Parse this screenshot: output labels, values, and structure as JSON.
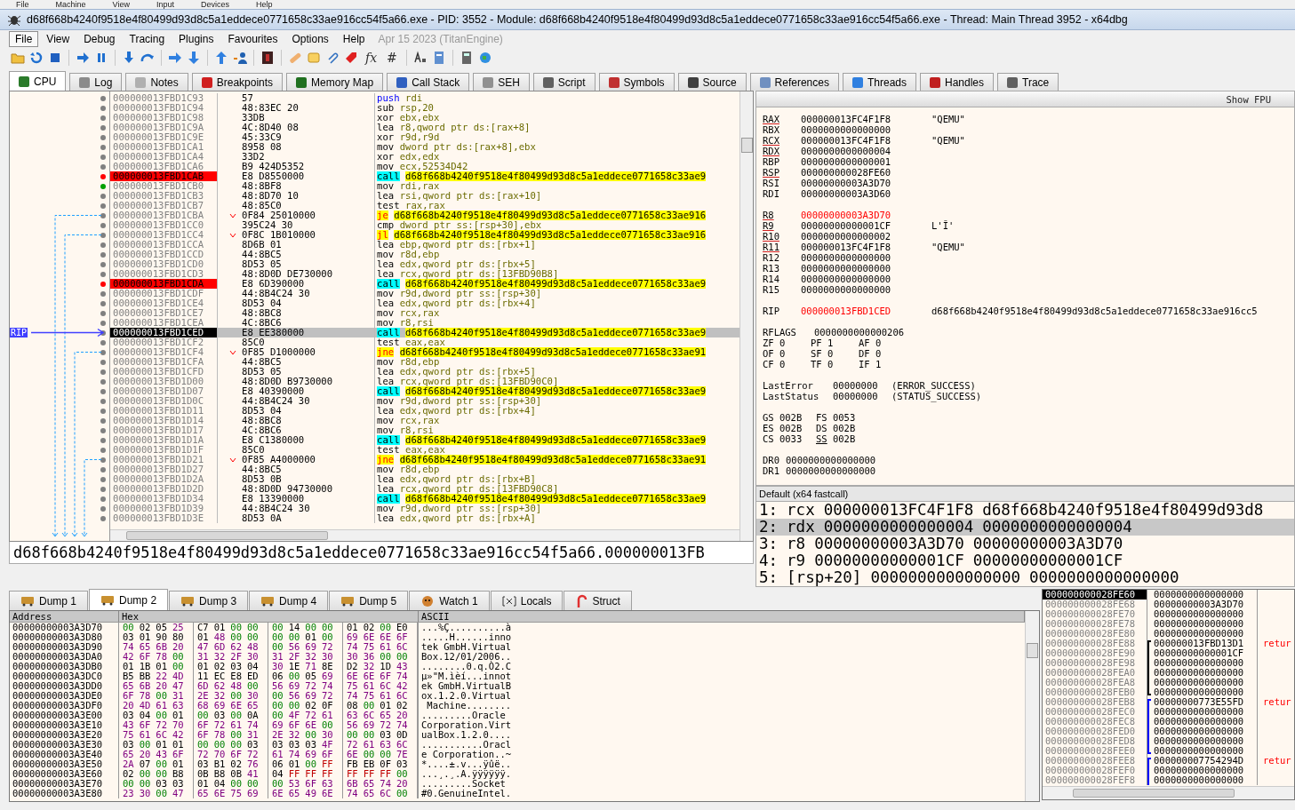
{
  "host_menu": [
    "File",
    "Machine",
    "View",
    "Input",
    "Devices",
    "Help"
  ],
  "title": "d68f668b4240f9518e4f80499d93d8c5a1eddece0771658c33ae916cc54f5a66.exe - PID: 3552 - Module: d68f668b4240f9518e4f80499d93d8c5a1eddece0771658c33ae916cc54f5a66.exe - Thread: Main Thread 3952 - x64dbg",
  "menu": {
    "items": [
      {
        "label": "File",
        "selected": true
      },
      {
        "label": "View",
        "selected": false
      },
      {
        "label": "Debug",
        "selected": false
      },
      {
        "label": "Tracing",
        "selected": false
      },
      {
        "label": "Plugins",
        "selected": false
      },
      {
        "label": "Favourites",
        "selected": false
      },
      {
        "label": "Options",
        "selected": false
      },
      {
        "label": "Help",
        "selected": false
      }
    ],
    "build": "Apr 15 2023 (TitanEngine)"
  },
  "toolbar": {
    "glyphs": [
      "fx",
      "#"
    ]
  },
  "tabs": [
    {
      "label": "CPU",
      "selected": true
    },
    {
      "label": "Log",
      "selected": false
    },
    {
      "label": "Notes",
      "selected": false
    },
    {
      "label": "Breakpoints",
      "selected": false
    },
    {
      "label": "Memory Map",
      "selected": false
    },
    {
      "label": "Call Stack",
      "selected": false
    },
    {
      "label": "SEH",
      "selected": false
    },
    {
      "label": "Script",
      "selected": false
    },
    {
      "label": "Symbols",
      "selected": false
    },
    {
      "label": "Source",
      "selected": false
    },
    {
      "label": "References",
      "selected": false
    },
    {
      "label": "Threads",
      "selected": false
    },
    {
      "label": "Handles",
      "selected": false
    },
    {
      "label": "Trace",
      "selected": false
    }
  ],
  "disasm": {
    "rip_label": "RIP",
    "rows": [
      {
        "address": "000000013FBD1C93",
        "bytes": "57",
        "mnemonic": "push",
        "operands": "rdi",
        "kind": "push",
        "breakpoint": false,
        "bookmark": false,
        "jump": false,
        "selected": false
      },
      {
        "address": "000000013FBD1C94",
        "bytes": "48:83EC 20",
        "mnemonic": "sub",
        "operands": "rsp,20",
        "kind": "plain",
        "breakpoint": false,
        "bookmark": false,
        "jump": false,
        "selected": false
      },
      {
        "address": "000000013FBD1C98",
        "bytes": "33DB",
        "mnemonic": "xor",
        "operands": "ebx,ebx",
        "kind": "plain",
        "breakpoint": false,
        "bookmark": false,
        "jump": false,
        "selected": false
      },
      {
        "address": "000000013FBD1C9A",
        "bytes": "4C:8D40 08",
        "mnemonic": "lea",
        "operands": "r8,qword ptr ds:[rax+8]",
        "kind": "plain",
        "breakpoint": false,
        "bookmark": false,
        "jump": false,
        "selected": false
      },
      {
        "address": "000000013FBD1C9E",
        "bytes": "45:33C9",
        "mnemonic": "xor",
        "operands": "r9d,r9d",
        "kind": "plain",
        "breakpoint": false,
        "bookmark": false,
        "jump": false,
        "selected": false
      },
      {
        "address": "000000013FBD1CA1",
        "bytes": "8958 08",
        "mnemonic": "mov",
        "operands": "dword ptr ds:[rax+8],ebx",
        "kind": "plain",
        "breakpoint": false,
        "bookmark": false,
        "jump": false,
        "selected": false
      },
      {
        "address": "000000013FBD1CA4",
        "bytes": "33D2",
        "mnemonic": "xor",
        "operands": "edx,edx",
        "kind": "plain",
        "breakpoint": false,
        "bookmark": false,
        "jump": false,
        "selected": false
      },
      {
        "address": "000000013FBD1CA6",
        "bytes": "B9 424D5352",
        "mnemonic": "mov",
        "operands": "ecx,52534D42",
        "kind": "plain",
        "breakpoint": false,
        "bookmark": false,
        "jump": false,
        "selected": false
      },
      {
        "address": "000000013FBD1CAB",
        "bytes": "E8 D8550000",
        "mnemonic": "call",
        "operands": "d68f668b4240f9518e4f80499d93d8c5a1eddece0771658c33ae9",
        "kind": "call",
        "breakpoint": true,
        "bookmark": false,
        "jump": false,
        "selected": false
      },
      {
        "address": "000000013FBD1CB0",
        "bytes": "48:8BF8",
        "mnemonic": "mov",
        "operands": "rdi,rax",
        "kind": "plain",
        "breakpoint": false,
        "bookmark": true,
        "jump": false,
        "selected": false
      },
      {
        "address": "000000013FBD1CB3",
        "bytes": "48:8D70 10",
        "mnemonic": "lea",
        "operands": "rsi,qword ptr ds:[rax+10]",
        "kind": "plain",
        "breakpoint": false,
        "bookmark": false,
        "jump": false,
        "selected": false
      },
      {
        "address": "000000013FBD1CB7",
        "bytes": "48:85C0",
        "mnemonic": "test",
        "operands": "rax,rax",
        "kind": "plain",
        "breakpoint": false,
        "bookmark": false,
        "jump": false,
        "selected": false
      },
      {
        "address": "000000013FBD1CBA",
        "bytes": "0F84 25010000",
        "mnemonic": "je",
        "operands": "d68f668b4240f9518e4f80499d93d8c5a1eddece0771658c33ae916",
        "kind": "jump",
        "breakpoint": false,
        "bookmark": false,
        "jump": true,
        "selected": false
      },
      {
        "address": "000000013FBD1CC0",
        "bytes": "395C24 30",
        "mnemonic": "cmp",
        "operands": "dword ptr ss:[rsp+30],ebx",
        "kind": "plain",
        "breakpoint": false,
        "bookmark": false,
        "jump": false,
        "selected": false
      },
      {
        "address": "000000013FBD1CC4",
        "bytes": "0F8C 1B010000",
        "mnemonic": "jl",
        "operands": "d68f668b4240f9518e4f80499d93d8c5a1eddece0771658c33ae916",
        "kind": "jump",
        "breakpoint": false,
        "bookmark": false,
        "jump": true,
        "selected": false
      },
      {
        "address": "000000013FBD1CCA",
        "bytes": "8D6B 01",
        "mnemonic": "lea",
        "operands": "ebp,qword ptr ds:[rbx+1]",
        "kind": "plain",
        "breakpoint": false,
        "bookmark": false,
        "jump": false,
        "selected": false
      },
      {
        "address": "000000013FBD1CCD",
        "bytes": "44:8BC5",
        "mnemonic": "mov",
        "operands": "r8d,ebp",
        "kind": "plain",
        "breakpoint": false,
        "bookmark": false,
        "jump": false,
        "selected": false
      },
      {
        "address": "000000013FBD1CD0",
        "bytes": "8D53 05",
        "mnemonic": "lea",
        "operands": "edx,qword ptr ds:[rbx+5]",
        "kind": "plain",
        "breakpoint": false,
        "bookmark": false,
        "jump": false,
        "selected": false
      },
      {
        "address": "000000013FBD1CD3",
        "bytes": "48:8D0D DE730000",
        "mnemonic": "lea",
        "operands": "rcx,qword ptr ds:[13FBD90B8]",
        "kind": "plain",
        "breakpoint": false,
        "bookmark": false,
        "jump": false,
        "selected": false
      },
      {
        "address": "000000013FBD1CDA",
        "bytes": "E8 6D390000",
        "mnemonic": "call",
        "operands": "d68f668b4240f9518e4f80499d93d8c5a1eddece0771658c33ae9",
        "kind": "call",
        "breakpoint": true,
        "bookmark": false,
        "jump": false,
        "selected": false
      },
      {
        "address": "000000013FBD1CDF",
        "bytes": "44:8B4C24 30",
        "mnemonic": "mov",
        "operands": "r9d,dword ptr ss:[rsp+30]",
        "kind": "plain",
        "breakpoint": false,
        "bookmark": false,
        "jump": false,
        "selected": false
      },
      {
        "address": "000000013FBD1CE4",
        "bytes": "8D53 04",
        "mnemonic": "lea",
        "operands": "edx,qword ptr ds:[rbx+4]",
        "kind": "plain",
        "breakpoint": false,
        "bookmark": false,
        "jump": false,
        "selected": false
      },
      {
        "address": "000000013FBD1CE7",
        "bytes": "48:8BC8",
        "mnemonic": "mov",
        "operands": "rcx,rax",
        "kind": "plain",
        "breakpoint": false,
        "bookmark": false,
        "jump": false,
        "selected": false
      },
      {
        "address": "000000013FBD1CEA",
        "bytes": "4C:8BC6",
        "mnemonic": "mov",
        "operands": "r8,rsi",
        "kind": "plain",
        "breakpoint": false,
        "bookmark": false,
        "jump": false,
        "selected": false
      },
      {
        "address": "000000013FBD1CED",
        "bytes": "E8 EE380000",
        "mnemonic": "call",
        "operands": "d68f668b4240f9518e4f80499d93d8c5a1eddece0771658c33ae9",
        "kind": "call",
        "breakpoint": false,
        "bookmark": false,
        "jump": false,
        "selected": true
      },
      {
        "address": "000000013FBD1CF2",
        "bytes": "85C0",
        "mnemonic": "test",
        "operands": "eax,eax",
        "kind": "plain",
        "breakpoint": false,
        "bookmark": false,
        "jump": false,
        "selected": false
      },
      {
        "address": "000000013FBD1CF4",
        "bytes": "0F85 D1000000",
        "mnemonic": "jne",
        "operands": "d68f668b4240f9518e4f80499d93d8c5a1eddece0771658c33ae91",
        "kind": "jump",
        "breakpoint": false,
        "bookmark": false,
        "jump": true,
        "selected": false
      },
      {
        "address": "000000013FBD1CFA",
        "bytes": "44:8BC5",
        "mnemonic": "mov",
        "operands": "r8d,ebp",
        "kind": "plain",
        "breakpoint": false,
        "bookmark": false,
        "jump": false,
        "selected": false
      },
      {
        "address": "000000013FBD1CFD",
        "bytes": "8D53 05",
        "mnemonic": "lea",
        "operands": "edx,qword ptr ds:[rbx+5]",
        "kind": "plain",
        "breakpoint": false,
        "bookmark": false,
        "jump": false,
        "selected": false
      },
      {
        "address": "000000013FBD1D00",
        "bytes": "48:8D0D B9730000",
        "mnemonic": "lea",
        "operands": "rcx,qword ptr ds:[13FBD90C0]",
        "kind": "plain",
        "breakpoint": false,
        "bookmark": false,
        "jump": false,
        "selected": false
      },
      {
        "address": "000000013FBD1D07",
        "bytes": "E8 40390000",
        "mnemonic": "call",
        "operands": "d68f668b4240f9518e4f80499d93d8c5a1eddece0771658c33ae9",
        "kind": "call",
        "breakpoint": false,
        "bookmark": false,
        "jump": false,
        "selected": false
      },
      {
        "address": "000000013FBD1D0C",
        "bytes": "44:8B4C24 30",
        "mnemonic": "mov",
        "operands": "r9d,dword ptr ss:[rsp+30]",
        "kind": "plain",
        "breakpoint": false,
        "bookmark": false,
        "jump": false,
        "selected": false
      },
      {
        "address": "000000013FBD1D11",
        "bytes": "8D53 04",
        "mnemonic": "lea",
        "operands": "edx,qword ptr ds:[rbx+4]",
        "kind": "plain",
        "breakpoint": false,
        "bookmark": false,
        "jump": false,
        "selected": false
      },
      {
        "address": "000000013FBD1D14",
        "bytes": "48:8BC8",
        "mnemonic": "mov",
        "operands": "rcx,rax",
        "kind": "plain",
        "breakpoint": false,
        "bookmark": false,
        "jump": false,
        "selected": false
      },
      {
        "address": "000000013FBD1D17",
        "bytes": "4C:8BC6",
        "mnemonic": "mov",
        "operands": "r8,rsi",
        "kind": "plain",
        "breakpoint": false,
        "bookmark": false,
        "jump": false,
        "selected": false
      },
      {
        "address": "000000013FBD1D1A",
        "bytes": "E8 C1380000",
        "mnemonic": "call",
        "operands": "d68f668b4240f9518e4f80499d93d8c5a1eddece0771658c33ae9",
        "kind": "call",
        "breakpoint": false,
        "bookmark": false,
        "jump": false,
        "selected": false
      },
      {
        "address": "000000013FBD1D1F",
        "bytes": "85C0",
        "mnemonic": "test",
        "operands": "eax,eax",
        "kind": "plain",
        "breakpoint": false,
        "bookmark": false,
        "jump": false,
        "selected": false
      },
      {
        "address": "000000013FBD1D21",
        "bytes": "0F85 A4000000",
        "mnemonic": "jne",
        "operands": "d68f668b4240f9518e4f80499d93d8c5a1eddece0771658c33ae91",
        "kind": "jump",
        "breakpoint": false,
        "bookmark": false,
        "jump": true,
        "selected": false
      },
      {
        "address": "000000013FBD1D27",
        "bytes": "44:8BC5",
        "mnemonic": "mov",
        "operands": "r8d,ebp",
        "kind": "plain",
        "breakpoint": false,
        "bookmark": false,
        "jump": false,
        "selected": false
      },
      {
        "address": "000000013FBD1D2A",
        "bytes": "8D53 0B",
        "mnemonic": "lea",
        "operands": "edx,qword ptr ds:[rbx+B]",
        "kind": "plain",
        "breakpoint": false,
        "bookmark": false,
        "jump": false,
        "selected": false
      },
      {
        "address": "000000013FBD1D2D",
        "bytes": "48:8D0D 94730000",
        "mnemonic": "lea",
        "operands": "rcx,qword ptr ds:[13FBD90C8]",
        "kind": "plain",
        "breakpoint": false,
        "bookmark": false,
        "jump": false,
        "selected": false
      },
      {
        "address": "000000013FBD1D34",
        "bytes": "E8 13390000",
        "mnemonic": "call",
        "operands": "d68f668b4240f9518e4f80499d93d8c5a1eddece0771658c33ae9",
        "kind": "call",
        "breakpoint": false,
        "bookmark": false,
        "jump": false,
        "selected": false
      },
      {
        "address": "000000013FBD1D39",
        "bytes": "44:8B4C24 30",
        "mnemonic": "mov",
        "operands": "r9d,dword ptr ss:[rsp+30]",
        "kind": "plain",
        "breakpoint": false,
        "bookmark": false,
        "jump": false,
        "selected": false
      },
      {
        "address": "000000013FBD1D3E",
        "bytes": "8D53 0A",
        "mnemonic": "lea",
        "operands": "edx,qword ptr ds:[rbx+A]",
        "kind": "plain",
        "breakpoint": false,
        "bookmark": false,
        "jump": false,
        "selected": false
      }
    ],
    "info": "d68f668b4240f9518e4f80499d93d8c5a1eddece0771658c33ae916cc54f5a66.000000013FB"
  },
  "registers": {
    "button": "Show FPU",
    "groups": [
      [
        {
          "name": "RAX",
          "value": "000000013FC4F1F8",
          "comment": "\"QEMU\"",
          "underlined": true,
          "changed": false
        },
        {
          "name": "RBX",
          "value": "0000000000000000",
          "underlined": false,
          "changed": false
        },
        {
          "name": "RCX",
          "value": "000000013FC4F1F8",
          "comment": "\"QEMU\"",
          "underlined": true,
          "changed": false
        },
        {
          "name": "RDX",
          "value": "0000000000000004",
          "underlined": true,
          "changed": false
        },
        {
          "name": "RBP",
          "value": "0000000000000001",
          "underlined": false,
          "changed": false
        },
        {
          "name": "RSP",
          "value": "000000000028FE60",
          "underlined": true,
          "changed": false
        },
        {
          "name": "RSI",
          "value": "00000000003A3D70",
          "underlined": false,
          "changed": false
        },
        {
          "name": "RDI",
          "value": "00000000003A3D60",
          "underlined": false,
          "changed": false
        }
      ],
      [
        {
          "name": "R8",
          "value": "00000000003A3D70",
          "underlined": true,
          "changed": true
        },
        {
          "name": "R9",
          "value": "00000000000001CF",
          "comment": "L'Ĭ'",
          "underlined": true,
          "changed": false
        },
        {
          "name": "R10",
          "value": "0000000000000002",
          "underlined": true,
          "changed": false
        },
        {
          "name": "R11",
          "value": "000000013FC4F1F8",
          "comment": "\"QEMU\"",
          "underlined": true,
          "changed": false
        },
        {
          "name": "R12",
          "value": "0000000000000000",
          "underlined": false,
          "changed": false
        },
        {
          "name": "R13",
          "value": "0000000000000000",
          "underlined": false,
          "changed": false
        },
        {
          "name": "R14",
          "value": "0000000000000000",
          "underlined": false,
          "changed": false
        },
        {
          "name": "R15",
          "value": "0000000000000000",
          "underlined": false,
          "changed": false
        }
      ],
      [
        {
          "name": "RIP",
          "value": "000000013FBD1CED",
          "comment": "d68f668b4240f9518e4f80499d93d8c5a1eddece0771658c33ae916cc5",
          "underlined": false,
          "changed": true
        }
      ]
    ],
    "rflags": {
      "name": "RFLAGS",
      "value": "0000000000000206"
    },
    "flags": [
      [
        {
          "name": "ZF",
          "value": "0"
        },
        {
          "name": "PF",
          "value": "1"
        },
        {
          "name": "AF",
          "value": "0"
        }
      ],
      [
        {
          "name": "OF",
          "value": "0"
        },
        {
          "name": "SF",
          "value": "0"
        },
        {
          "name": "DF",
          "value": "0"
        }
      ],
      [
        {
          "name": "CF",
          "value": "0"
        },
        {
          "name": "TF",
          "value": "0"
        },
        {
          "name": "IF",
          "value": "1"
        }
      ]
    ],
    "status": [
      {
        "name": "LastError",
        "value": "00000000",
        "comment": "(ERROR_SUCCESS)"
      },
      {
        "name": "LastStatus",
        "value": "00000000",
        "comment": "(STATUS_SUCCESS)"
      }
    ],
    "segments": [
      [
        {
          "name": "GS",
          "value": "002B",
          "underlined": false
        },
        {
          "name": "FS",
          "value": "0053",
          "underlined": false
        }
      ],
      [
        {
          "name": "ES",
          "value": "002B",
          "underlined": false
        },
        {
          "name": "DS",
          "value": "002B",
          "underlined": false
        }
      ],
      [
        {
          "name": "CS",
          "value": "0033",
          "underlined": false
        },
        {
          "name": "SS",
          "value": "002B",
          "underlined": true
        }
      ]
    ],
    "debug_registers": [
      {
        "name": "DR0",
        "value": "0000000000000000"
      },
      {
        "name": "DR1",
        "value": "0000000000000000"
      }
    ]
  },
  "call_convention": {
    "title": "Default (x64 fastcall)",
    "rows": [
      {
        "index": "1:",
        "reg": "rcx",
        "value": "000000013FC4F1F8",
        "comment": "d68f668b4240f9518e4f80499d93d8",
        "selected": false
      },
      {
        "index": "2:",
        "reg": "rdx",
        "value": "0000000000000004",
        "comment": "0000000000000004",
        "selected": true
      },
      {
        "index": "3:",
        "reg": "r8",
        "value": "00000000003A3D70",
        "comment": "00000000003A3D70",
        "selected": false
      },
      {
        "index": "4:",
        "reg": "r9",
        "value": "00000000000001CF",
        "comment": "00000000000001CF",
        "selected": false
      },
      {
        "index": "5:",
        "reg": "[rsp+20]",
        "value": "0000000000000000",
        "comment": "0000000000000000",
        "selected": false
      }
    ]
  },
  "dump_tabs": [
    {
      "label": "Dump 1",
      "selected": false,
      "kind": "dump"
    },
    {
      "label": "Dump 2",
      "selected": true,
      "kind": "dump"
    },
    {
      "label": "Dump 3",
      "selected": false,
      "kind": "dump"
    },
    {
      "label": "Dump 4",
      "selected": false,
      "kind": "dump"
    },
    {
      "label": "Dump 5",
      "selected": false,
      "kind": "dump"
    },
    {
      "label": "Watch 1",
      "selected": false,
      "kind": "watch"
    },
    {
      "label": "Locals",
      "selected": false,
      "kind": "locals"
    },
    {
      "label": "Struct",
      "selected": false,
      "kind": "struct"
    }
  ],
  "dump": {
    "columns": [
      "Address",
      "Hex",
      "ASCII"
    ],
    "rows": [
      {
        "address": "00000000003A3D70",
        "hex": "00 02 05 25 C7 01 00 00 00 14 00 00 01 02 00 E0",
        "ascii": "...%Ç..........à"
      },
      {
        "address": "00000000003A3D80",
        "hex": "03 01 90 80 01 48 00 00 00 00 01 00 69 6E 6E 6F",
        "ascii": ".....H......inno"
      },
      {
        "address": "00000000003A3D90",
        "hex": "74 65 6B 20 47 6D 62 48 00 56 69 72 74 75 61 6C",
        "ascii": "tek GmbH.Virtual"
      },
      {
        "address": "00000000003A3DA0",
        "hex": "42 6F 78 00 31 32 2F 30 31 2F 32 30 30 36 00 00",
        "ascii": "Box.12/01/2006.."
      },
      {
        "address": "00000000003A3DB0",
        "hex": "01 1B 01 00 01 02 03 04 30 1E 71 8E D2 32 1D 43",
        "ascii": "........0.q.Ò2.C"
      },
      {
        "address": "00000000003A3DC0",
        "hex": "B5 BB 22 4D 11 EC E8 ED 06 00 05 69 6E 6E 6F 74",
        "ascii": "µ»\"M.ìèí...innot"
      },
      {
        "address": "00000000003A3DD0",
        "hex": "65 6B 20 47 6D 62 48 00 56 69 72 74 75 61 6C 42",
        "ascii": "ek GmbH.VirtualB"
      },
      {
        "address": "00000000003A3DE0",
        "hex": "6F 78 00 31 2E 32 00 30 00 56 69 72 74 75 61 6C",
        "ascii": "ox.1.2.0.Virtual"
      },
      {
        "address": "00000000003A3DF0",
        "hex": "20 4D 61 63 68 69 6E 65 00 00 02 0F 08 00 01 02",
        "ascii": " Machine........"
      },
      {
        "address": "00000000003A3E00",
        "hex": "03 04 00 01 00 03 00 0A 00 4F 72 61 63 6C 65 20",
        "ascii": ".........Oracle "
      },
      {
        "address": "00000000003A3E10",
        "hex": "43 6F 72 70 6F 72 61 74 69 6F 6E 00 56 69 72 74",
        "ascii": "Corporation.Virt"
      },
      {
        "address": "00000000003A3E20",
        "hex": "75 61 6C 42 6F 78 00 31 2E 32 00 30 00 00 03 0D",
        "ascii": "ualBox.1.2.0...."
      },
      {
        "address": "00000000003A3E30",
        "hex": "03 00 01 01 00 00 00 03 03 03 03 4F 72 61 63 6C",
        "ascii": "...........Oracl"
      },
      {
        "address": "00000000003A3E40",
        "hex": "65 20 43 6F 72 70 6F 72 61 74 69 6F 6E 00 00 7E",
        "ascii": "e Corporation..~"
      },
      {
        "address": "00000000003A3E50",
        "hex": "2A 07 00 01 03 B1 02 76 06 01 00 FF FB EB 0F 03",
        "ascii": "*....±.v...ÿûë.."
      },
      {
        "address": "00000000003A3E60",
        "hex": "02 00 00 B8 0B B8 0B 41 04 FF FF FF FF FF FF 00",
        "ascii": "...¸.¸.A.ÿÿÿÿÿÿ."
      },
      {
        "address": "00000000003A3E70",
        "hex": "00 00 03 03 01 04 00 00 00 53 6F 63 6B 65 74 20",
        "ascii": ".........Socket "
      },
      {
        "address": "00000000003A3E80",
        "hex": "23 30 00 47 65 6E 75 69 6E 65 49 6E 74 65 6C 00",
        "ascii": "#0.GenuineIntel."
      }
    ]
  },
  "stack": {
    "rows": [
      {
        "address": "000000000028FE60",
        "value": "0000000000000000",
        "selected": true
      },
      {
        "address": "000000000028FE68",
        "value": "00000000003A3D70",
        "selected": false
      },
      {
        "address": "000000000028FE70",
        "value": "0000000000000000",
        "selected": false
      },
      {
        "address": "000000000028FE78",
        "value": "0000000000000000",
        "selected": false
      },
      {
        "address": "000000000028FE80",
        "value": "0000000000000000",
        "selected": false
      },
      {
        "address": "000000000028FE88",
        "value": "000000013FBD13D1",
        "comment": "retur",
        "selected": false,
        "frame_start": true,
        "frame_end": false,
        "color": "#000000"
      },
      {
        "address": "000000000028FE90",
        "value": "00000000000001CF",
        "selected": false,
        "frame_start": false,
        "frame_end": false,
        "color": "#000000"
      },
      {
        "address": "000000000028FE98",
        "value": "0000000000000000",
        "selected": false,
        "frame_start": false,
        "frame_end": false,
        "color": "#000000"
      },
      {
        "address": "000000000028FEA0",
        "value": "0000000000000000",
        "selected": false,
        "frame_start": false,
        "frame_end": false,
        "color": "#000000"
      },
      {
        "address": "000000000028FEA8",
        "value": "0000000000000000",
        "selected": false,
        "frame_start": false,
        "frame_end": false,
        "color": "#000000"
      },
      {
        "address": "000000000028FEB0",
        "value": "0000000000000000",
        "selected": false,
        "frame_start": false,
        "frame_end": true,
        "color": "#000000"
      },
      {
        "address": "000000000028FEB8",
        "value": "00000000773E55FD",
        "comment": "retur",
        "selected": false,
        "frame_start": true,
        "frame_end": false,
        "color": "#0000ff"
      },
      {
        "address": "000000000028FEC0",
        "value": "0000000000000000",
        "selected": false,
        "frame_start": false,
        "frame_end": false,
        "color": "#0000ff"
      },
      {
        "address": "000000000028FEC8",
        "value": "0000000000000000",
        "selected": false,
        "frame_start": false,
        "frame_end": false,
        "color": "#0000ff"
      },
      {
        "address": "000000000028FED0",
        "value": "0000000000000000",
        "selected": false,
        "frame_start": false,
        "frame_end": false,
        "color": "#0000ff"
      },
      {
        "address": "000000000028FED8",
        "value": "0000000000000000",
        "selected": false,
        "frame_start": false,
        "frame_end": false,
        "color": "#0000ff"
      },
      {
        "address": "000000000028FEE0",
        "value": "0000000000000000",
        "selected": false,
        "frame_start": false,
        "frame_end": true,
        "color": "#0000ff"
      },
      {
        "address": "000000000028FEE8",
        "value": "000000007754294D",
        "comment": "retur",
        "selected": false,
        "frame_start": true,
        "frame_end": false,
        "color": "#0000ff"
      },
      {
        "address": "000000000028FEF0",
        "value": "0000000000000000",
        "selected": false,
        "frame_start": false,
        "frame_end": false,
        "color": "#0000ff"
      },
      {
        "address": "000000000028FEF8",
        "value": "0000000000000000",
        "selected": false,
        "frame_start": false,
        "frame_end": false,
        "color": "#0000ff"
      }
    ]
  }
}
